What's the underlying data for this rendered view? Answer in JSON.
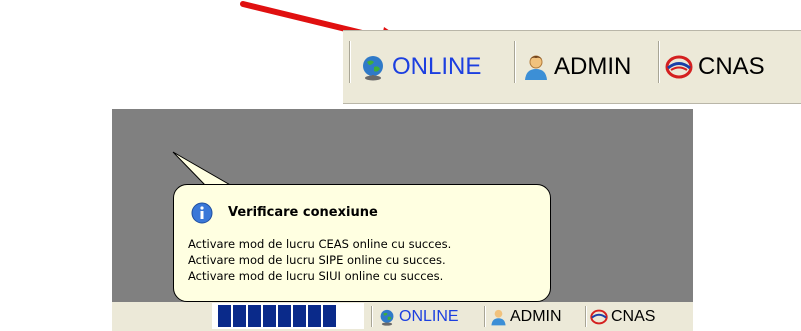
{
  "statusbar": {
    "online_label": "ONLINE",
    "admin_label": "ADMIN",
    "cnas_label": "CNAS",
    "online_icon": "globe-icon",
    "admin_icon": "user-icon",
    "cnas_icon": "cnas-logo-icon"
  },
  "balloon": {
    "title": "Verificare conexiune",
    "icon": "info-icon",
    "lines": [
      "Activare mod de lucru CEAS online cu succes.",
      "Activare mod de lucru SIPE online cu succes.",
      "Activare mod de lucru SIUI online cu succes."
    ]
  },
  "progress": {
    "segments": 8,
    "fill_fraction": 1.0
  },
  "colors": {
    "accent_blue": "#1c3fe0",
    "arrow_red": "#e01010",
    "balloon_bg": "#ffffe1"
  }
}
